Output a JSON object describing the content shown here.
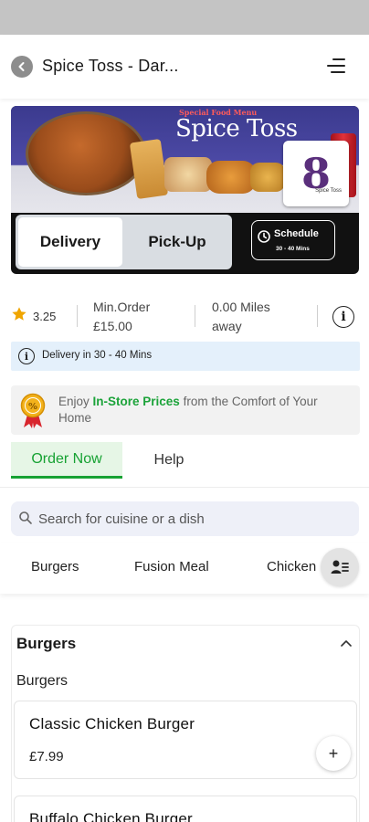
{
  "header": {
    "title": "Spice Toss - Dar...",
    "back_icon": "chevron-left-icon",
    "menu_icon": "hamburger-menu-icon"
  },
  "hero": {
    "banner_tag": "Special Food Menu",
    "banner_brand": "Spice Toss",
    "logo_mark": "8",
    "logo_small": "Spice Toss",
    "delivery_label": "Delivery",
    "pickup_label": "Pick-Up",
    "schedule_label": "Schedule",
    "schedule_sub": "30 - 40 Mins",
    "selected_mode": "Delivery"
  },
  "stats": {
    "rating": "3.25",
    "min_order_line1": "Min.Order",
    "min_order_line2": "£15.00",
    "distance_line1": "0.00 Miles",
    "distance_line2": "away",
    "info_icon": "info-icon"
  },
  "delivery_banner": {
    "text": "Delivery in 30 - 40 Mins"
  },
  "promo": {
    "prefix": "Enjoy ",
    "highlight": "In-Store Prices",
    "suffix": " from the Comfort of Your Home",
    "badge_icon": "discount-badge-icon"
  },
  "tabs": {
    "order_now": "Order Now",
    "help": "Help"
  },
  "search": {
    "placeholder": "Search for cuisine or a dish"
  },
  "categories": [
    "Burgers",
    "Fusion Meal",
    "Chicken"
  ],
  "menu_section": {
    "title": "Burgers",
    "subheading": "Burgers",
    "items": [
      {
        "name": "Classic Chicken Burger",
        "price": "£7.99"
      },
      {
        "name": "Buffalo Chicken Burger",
        "price": ""
      }
    ],
    "add_label": "+"
  },
  "colors": {
    "accent_green": "#17a233",
    "tab_bg": "#e6f6e6",
    "info_bg": "#e4f0fb",
    "star": "#f0a500"
  }
}
